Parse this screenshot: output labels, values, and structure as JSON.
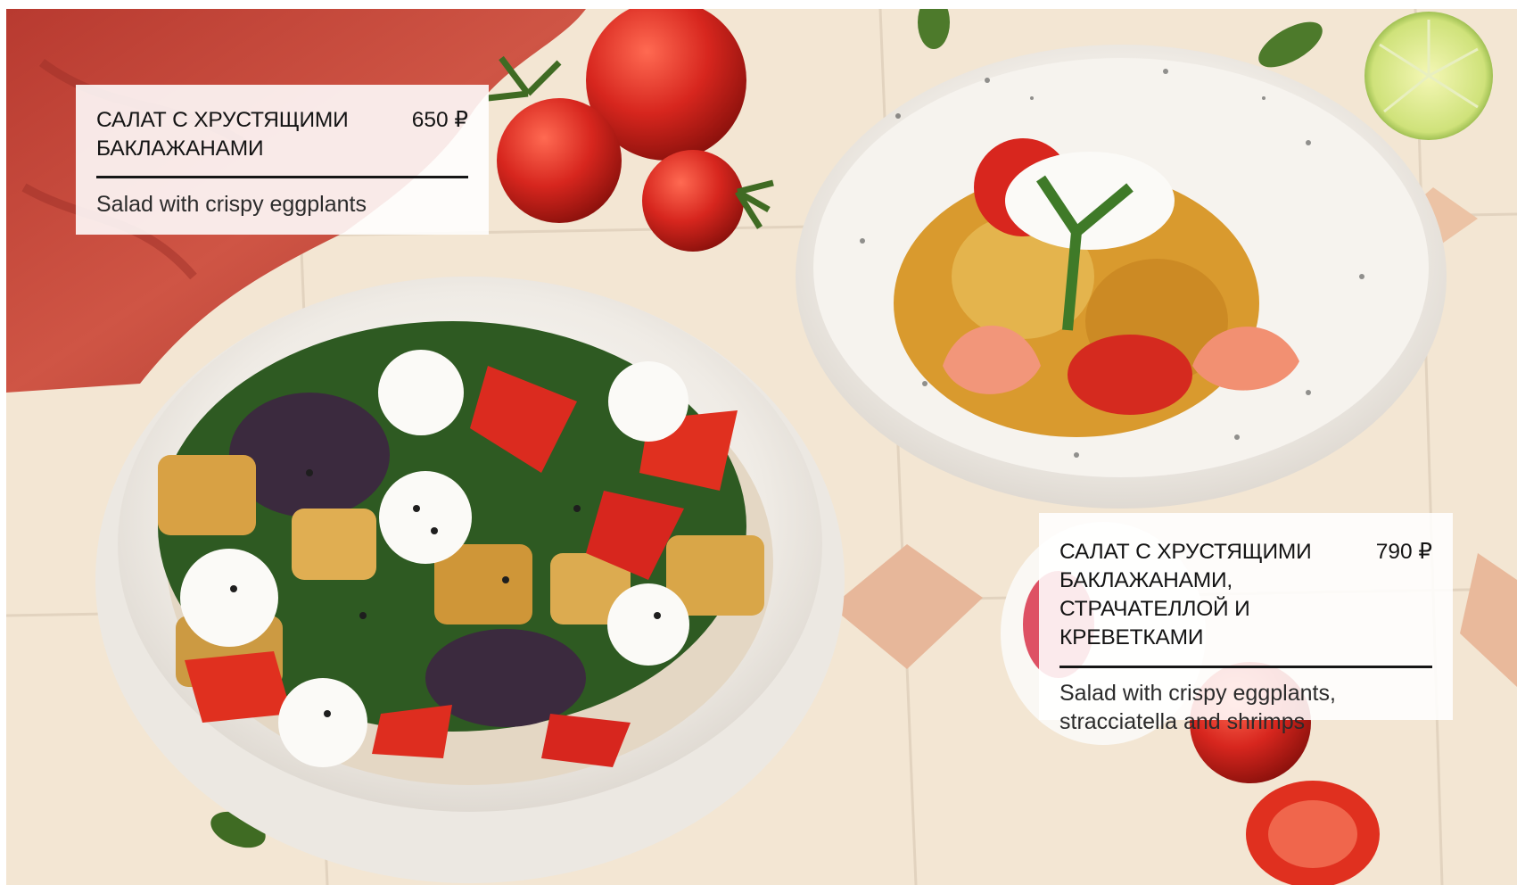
{
  "photo": {
    "subject_icons": [
      "eggplant-salad-bowl-icon",
      "shrimp-salad-bowl-icon",
      "tomato-icon",
      "lime-icon",
      "napkin-icon"
    ],
    "colors": {
      "tile": "#f3e6d3",
      "terracotta_tile": "#e7b79a",
      "napkin": "#c2483a",
      "tomato": "#d7261e",
      "bowl_white": "#f2efea"
    }
  },
  "cards": [
    {
      "name_lines": [
        "САЛАТ С ХРУСТЯЩИМИ",
        "БАКЛАЖАНАМИ"
      ],
      "price": "650 ₽",
      "description_lines": [
        "Salad with crispy eggplants"
      ]
    },
    {
      "name_lines": [
        "САЛАТ С ХРУСТЯЩИМИ",
        "БАКЛАЖАНАМИ,",
        "СТРАЧАТЕЛЛОЙ И КРЕВЕТКАМИ"
      ],
      "price": "790 ₽",
      "description_lines": [
        "Salad with crispy eggplants,",
        "stracciatella and shrimps"
      ]
    }
  ]
}
